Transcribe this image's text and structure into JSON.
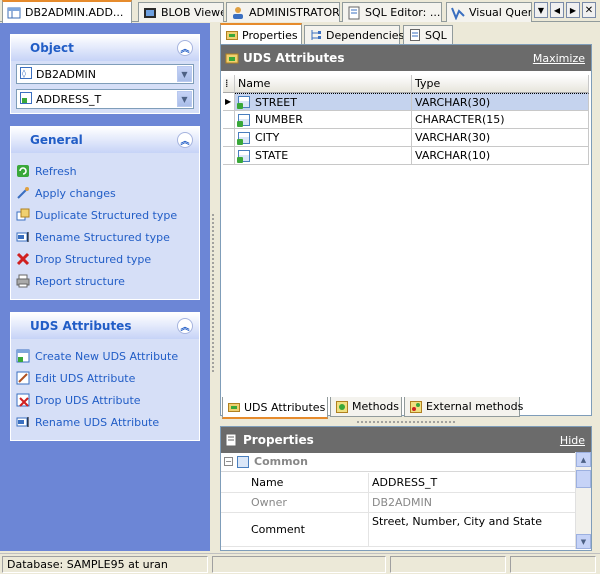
{
  "doc_tabs": [
    {
      "label": "DB2ADMIN.ADD...",
      "icon": "table-icon",
      "active": true
    },
    {
      "label": "BLOB Viewer",
      "icon": "blob-icon"
    },
    {
      "label": "ADMINISTRATOR",
      "icon": "user-icon"
    },
    {
      "label": "SQL Editor: ...",
      "icon": "sql-editor-icon"
    },
    {
      "label": "Visual Query",
      "icon": "visual-query-icon"
    }
  ],
  "object_panel": {
    "title": "Object",
    "database": "DB2ADMIN",
    "object": "ADDRESS_T"
  },
  "general_panel": {
    "title": "General",
    "items": [
      {
        "label": "Refresh",
        "icon": "refresh-icon"
      },
      {
        "label": "Apply changes",
        "icon": "apply-icon"
      },
      {
        "label": "Duplicate Structured type",
        "icon": "duplicate-icon"
      },
      {
        "label": "Rename Structured type",
        "icon": "rename-icon"
      },
      {
        "label": "Drop Structured type",
        "icon": "drop-icon"
      },
      {
        "label": "Report structure",
        "icon": "report-icon"
      }
    ]
  },
  "uds_panel": {
    "title": "UDS Attributes",
    "items": [
      {
        "label": "Create New UDS Attribute",
        "icon": "create-icon"
      },
      {
        "label": "Edit UDS Attribute",
        "icon": "edit-icon"
      },
      {
        "label": "Drop UDS Attribute",
        "icon": "drop-icon"
      },
      {
        "label": "Rename UDS Attribute",
        "icon": "rename-icon"
      }
    ]
  },
  "prop_tabs": [
    {
      "label": "Properties",
      "active": true
    },
    {
      "label": "Dependencies"
    },
    {
      "label": "SQL"
    }
  ],
  "uds_section": {
    "title": "UDS Attributes",
    "action": "Maximize"
  },
  "grid": {
    "columns": [
      "Name",
      "Type"
    ],
    "rows": [
      {
        "name": "STREET",
        "type": "VARCHAR(30)",
        "selected": true
      },
      {
        "name": "NUMBER",
        "type": "CHARACTER(15)"
      },
      {
        "name": "CITY",
        "type": "VARCHAR(30)"
      },
      {
        "name": "STATE",
        "type": "VARCHAR(10)"
      }
    ]
  },
  "bottom_tabs": [
    {
      "label": "UDS Attributes",
      "active": true
    },
    {
      "label": "Methods"
    },
    {
      "label": "External methods"
    }
  ],
  "properties": {
    "title": "Properties",
    "action": "Hide",
    "category": "Common",
    "rows": [
      {
        "key": "Name",
        "value": "ADDRESS_T"
      },
      {
        "key": "Owner",
        "value": "DB2ADMIN",
        "disabled": true
      },
      {
        "key": "Comment",
        "value": "Street, Number, City and State"
      }
    ]
  },
  "status": {
    "database": "Database: SAMPLE95 at uran"
  },
  "colors": {
    "panel_bg": "#d6dff7",
    "left_bg": "#6c86d6",
    "link": "#215dc6",
    "accent": "#e68b2c",
    "section_head": "#6b6b6b"
  }
}
